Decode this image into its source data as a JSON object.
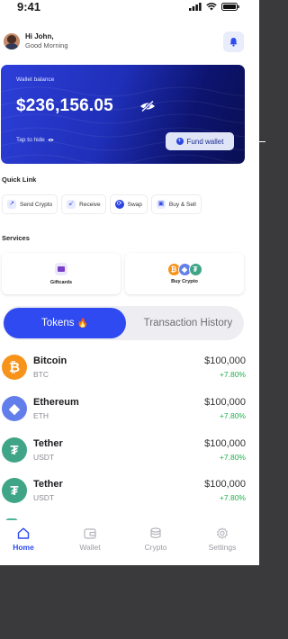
{
  "status_bar": {
    "time": "9:41"
  },
  "header": {
    "greeting": "Hi John,",
    "subtitle": "Good Morning"
  },
  "wallet_card": {
    "label": "Wallet balance",
    "amount": "$236,156.05",
    "tap_to_hide": "Tap to hide",
    "fund_button": "Fund wallet"
  },
  "quick_link": {
    "title": "Quick Link",
    "items": [
      {
        "label": "Send Crypto",
        "icon": "arrow-up-right-icon"
      },
      {
        "label": "Receive",
        "icon": "arrow-down-left-icon"
      },
      {
        "label": "Swap",
        "icon": "swap-icon"
      },
      {
        "label": "Buy & Sell",
        "icon": "buy-sell-icon"
      }
    ]
  },
  "services": {
    "title": "Services",
    "items": [
      {
        "label": "Giftcards",
        "icon": "giftcard-icon"
      },
      {
        "label": "Buy Crypto",
        "icon": "crypto-coins-icon"
      }
    ]
  },
  "tabs": {
    "active": "Tokens",
    "active_emoji": "🔥",
    "inactive": "Transaction History"
  },
  "tokens": [
    {
      "name": "Bitcoin",
      "symbol": "BTC",
      "price": "$100,000",
      "change": "+7.80%",
      "color": "#f7931a",
      "glyph": "₿"
    },
    {
      "name": "Ethereum",
      "symbol": "ETH",
      "price": "$100,000",
      "change": "+7.80%",
      "color": "#627eea",
      "glyph": "◆"
    },
    {
      "name": "Tether",
      "symbol": "USDT",
      "price": "$100,000",
      "change": "+7.80%",
      "color": "#3fa586",
      "glyph": "₮"
    },
    {
      "name": "Tether",
      "symbol": "USDT",
      "price": "$100,000",
      "change": "+7.80%",
      "color": "#3fa586",
      "glyph": "₮"
    }
  ],
  "nav": [
    {
      "label": "Home",
      "icon": "home-icon",
      "active": true
    },
    {
      "label": "Wallet",
      "icon": "wallet-icon",
      "active": false
    },
    {
      "label": "Crypto",
      "icon": "coins-icon",
      "active": false
    },
    {
      "label": "Settings",
      "icon": "gear-icon",
      "active": false
    }
  ],
  "colors": {
    "primary": "#2e4af0",
    "positive": "#1fb14a",
    "card_dark": "#0a0f52"
  }
}
